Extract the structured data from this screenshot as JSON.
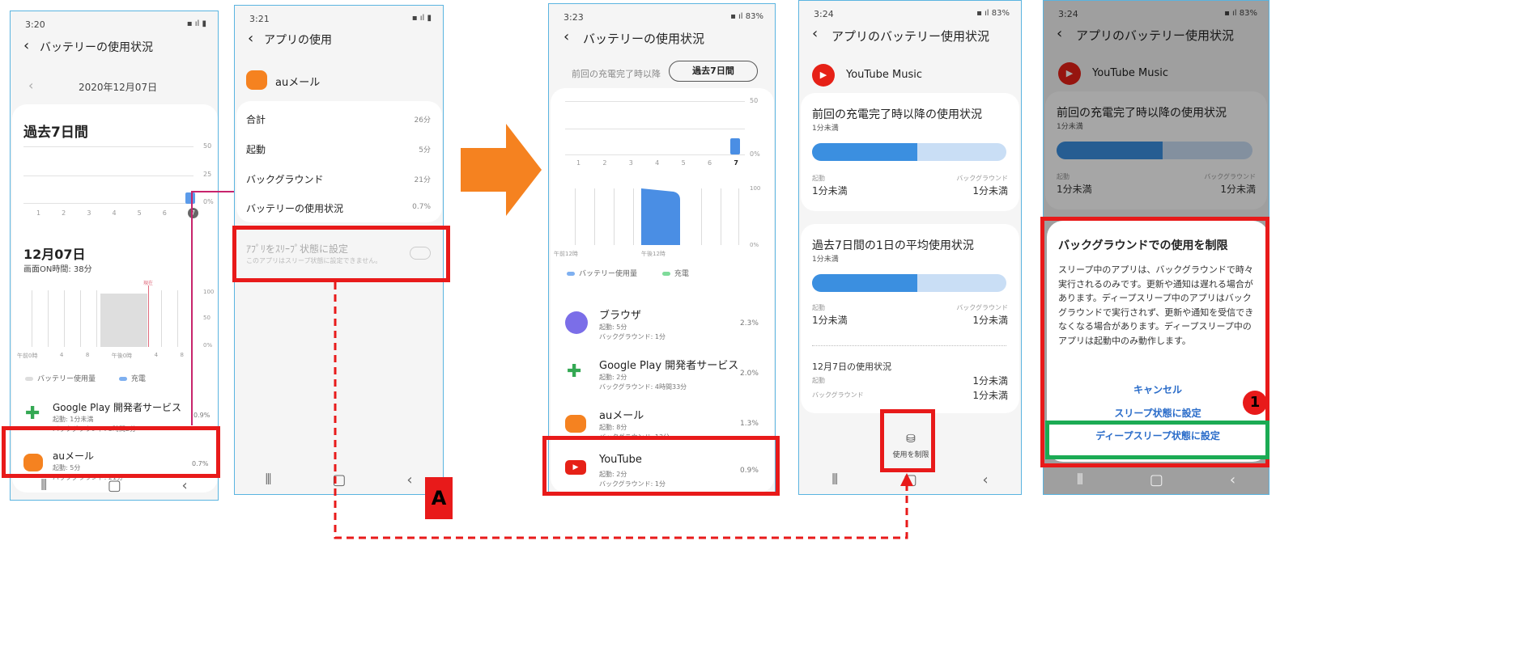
{
  "screens": [
    {
      "status_time": "3:20",
      "title": "バッテリーの使用状況",
      "date": "2020年12月07日",
      "period": "過去7日間",
      "chart_days": [
        "1",
        "2",
        "3",
        "4",
        "5",
        "6",
        "7"
      ],
      "chart_y": [
        "50",
        "25",
        "0%"
      ],
      "day_title": "12月07日",
      "screen_on": "画面ON時間: 38分",
      "now_label": "現在",
      "hourly_y": [
        "100",
        "50",
        "0%"
      ],
      "hourly_x": [
        "午前0時",
        "4",
        "8",
        "午後0時",
        "4",
        "8"
      ],
      "legend_usage": "バッテリー使用量",
      "legend_charge": "充電",
      "apps": [
        {
          "name": "Google Play 開発者サービス",
          "l1": "起動: 1分未満",
          "l2": "バックグラウンド: 5時間2分",
          "pct": "0.9%"
        },
        {
          "name": "auメール",
          "l1": "起動: 5分",
          "l2": "バックグラウンド: 21分",
          "pct": "0.7%"
        }
      ]
    },
    {
      "status_time": "3:21",
      "title": "アプリの使用",
      "app_name": "auメール",
      "rows": [
        {
          "label": "合計",
          "value": "26分"
        },
        {
          "label": "起動",
          "value": "5分"
        },
        {
          "label": "バックグラウンド",
          "value": "21分"
        },
        {
          "label": "バッテリーの使用状況",
          "value": "0.7%"
        }
      ],
      "sleep_title": "ｱﾌﾟﾘをｽﾘｰﾌﾟ状態に設定",
      "sleep_sub": "このアプリはスリープ状態に設定できません。"
    },
    {
      "status_time": "3:23",
      "status_right": "83%",
      "title": "バッテリーの使用状況",
      "since_label": "前回の充電完了時以降",
      "period_btn": "過去7日間",
      "chart_days": [
        "1",
        "2",
        "3",
        "4",
        "5",
        "6",
        "7"
      ],
      "chart_y": [
        "50",
        "0%"
      ],
      "hourly_y": [
        "100",
        "0%"
      ],
      "hourly_x": [
        "午前12時",
        "午後12時"
      ],
      "legend_usage": "バッテリー使用量",
      "legend_charge": "充電",
      "apps": [
        {
          "name": "ブラウザ",
          "l1": "起動: 5分",
          "l2": "バックグラウンド: 1分",
          "pct": "2.3%"
        },
        {
          "name": "Google Play 開発者サービス",
          "l1": "起動: 2分",
          "l2": "バックグラウンド: 4時間33分",
          "pct": "2.0%"
        },
        {
          "name": "auメール",
          "l1": "起動: 8分",
          "l2": "バックグラウンド: 13分",
          "pct": "1.3%"
        },
        {
          "name": "YouTube",
          "l1": "起動: 2分",
          "l2": "バックグラウンド: 1分",
          "pct": "0.9%"
        }
      ]
    },
    {
      "status_time": "3:24",
      "status_right": "83%",
      "title": "アプリのバッテリー使用状況",
      "app_name": "YouTube Music",
      "since_title": "前回の充電完了時以降の使用状況",
      "since_value": "1分未満",
      "since_fill": 0.54,
      "label_fg": "起動",
      "label_bg": "バックグラウンド",
      "since_fg": "1分未満",
      "since_bg": "1分未満",
      "avg_title": "過去7日間の1日の平均使用状況",
      "avg_value": "1分未満",
      "avg_fill": 0.54,
      "avg_fg": "1分未満",
      "avg_bg": "1分未満",
      "day_title": "12月7日の使用状況",
      "day_fg_label": "起動",
      "day_fg": "1分未満",
      "day_bg_label": "バックグラウンド",
      "day_bg": "1分未満",
      "restrict_label": "使用を制限"
    },
    {
      "status_time": "3:24",
      "status_right": "83%",
      "title": "アプリのバッテリー使用状況",
      "app_name": "YouTube Music",
      "since_title": "前回の充電完了時以降の使用状況",
      "since_value": "1分未満",
      "since_fill": 0.54,
      "label_fg": "起動",
      "label_bg": "バックグラウンド",
      "since_fg": "1分未満",
      "since_bg": "1分未満",
      "dialog_title": "バックグラウンドでの使用を制限",
      "dialog_body": "スリープ中のアプリは、バックグラウンドで時々実行されるのみです。更新や通知は遅れる場合があります。ディープスリープ中のアプリはバックグラウンドで実行されず、更新や通知を受信できなくなる場合があります。ディープスリープ中のアプリは起動中のみ動作します。",
      "btn_cancel": "キャンセル",
      "btn_sleep": "スリープ状態に設定",
      "btn_deep": "ディープスリープ状態に設定"
    }
  ],
  "annotations": {
    "label_a": "A",
    "label_1": "1"
  },
  "colors": {
    "arrow": "#f58220",
    "highlight_red": "#e81a1a",
    "highlight_green": "#1bab54",
    "bar_fill": "#3b8fe0",
    "bar_track": "#c9def5"
  }
}
